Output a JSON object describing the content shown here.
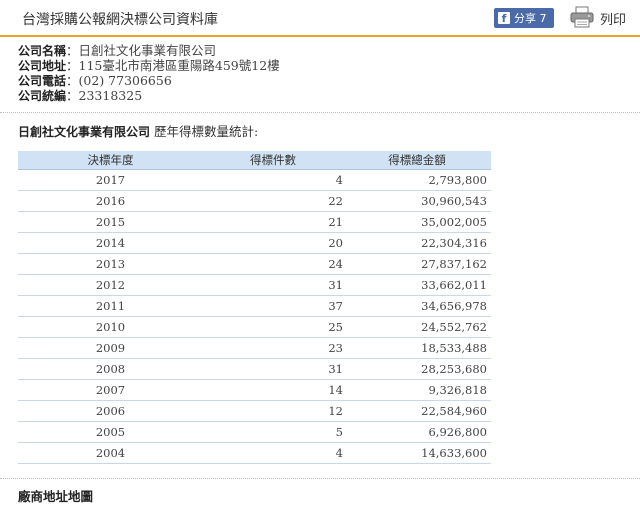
{
  "header": {
    "site_title": "台灣採購公報網決標公司資料庫",
    "share_label": "分享 7",
    "print_label": "列印",
    "accent_color": "#f0a030",
    "share_color": "#4a6aa8"
  },
  "company": {
    "name_label": "公司名稱",
    "name_value": "日創社文化事業有限公司",
    "address_label": "公司地址",
    "address_value": "115臺北市南港區重陽路459號12樓",
    "phone_label": "公司電話",
    "phone_value": "(02) 77306656",
    "tax_label": "公司統編",
    "tax_value": "23318325",
    "separator": "："
  },
  "stats": {
    "company_name": "日創社文化事業有限公司",
    "title_suffix": "歷年得標數量統計:",
    "columns": [
      "決標年度",
      "得標件數",
      "得標總金額"
    ],
    "header_color": "#d0e2f3",
    "rows": [
      {
        "year": "2017",
        "count": "4",
        "amount": "2,793,800"
      },
      {
        "year": "2016",
        "count": "22",
        "amount": "30,960,543"
      },
      {
        "year": "2015",
        "count": "21",
        "amount": "35,002,005"
      },
      {
        "year": "2014",
        "count": "20",
        "amount": "22,304,316"
      },
      {
        "year": "2013",
        "count": "24",
        "amount": "27,837,162"
      },
      {
        "year": "2012",
        "count": "31",
        "amount": "33,662,011"
      },
      {
        "year": "2011",
        "count": "37",
        "amount": "34,656,978"
      },
      {
        "year": "2010",
        "count": "25",
        "amount": "24,552,762"
      },
      {
        "year": "2009",
        "count": "23",
        "amount": "18,533,488"
      },
      {
        "year": "2008",
        "count": "31",
        "amount": "28,253,680"
      },
      {
        "year": "2007",
        "count": "14",
        "amount": "9,326,818"
      },
      {
        "year": "2006",
        "count": "12",
        "amount": "22,584,960"
      },
      {
        "year": "2005",
        "count": "5",
        "amount": "6,926,800"
      },
      {
        "year": "2004",
        "count": "4",
        "amount": "14,633,600"
      }
    ]
  },
  "footer": {
    "section_title": "廠商地址地圖"
  }
}
